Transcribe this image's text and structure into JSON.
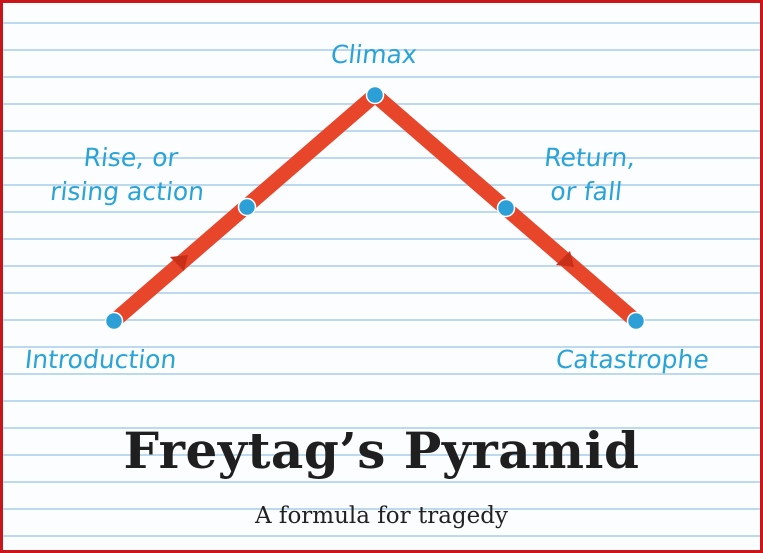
{
  "diagram": {
    "title": "Freytag’s Pyramid",
    "subtitle": "A formula for tragedy",
    "labels": {
      "climax": "Climax",
      "rise_line1": "Rise, or",
      "rise_line2": "rising action",
      "return_line1": "Return,",
      "return_line2": "or fall",
      "introduction": "Introduction",
      "catastrophe": "Catastrophe"
    },
    "colors": {
      "border": "#c8161b",
      "line": "#e8462a",
      "points": "#2b9fd6",
      "label_text": "#29a3d8",
      "ruled_lines": "#bcd9ee",
      "title_text": "#1f1f1f"
    }
  }
}
